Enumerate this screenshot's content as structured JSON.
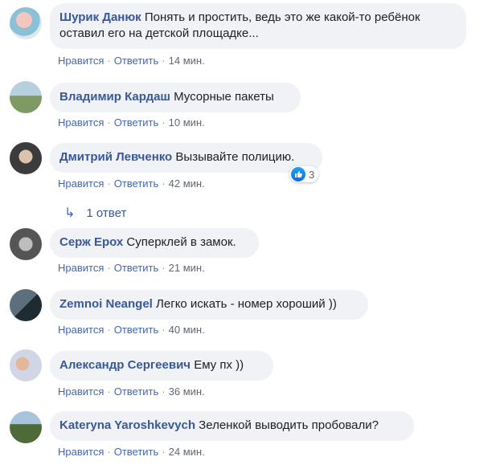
{
  "comments": [
    {
      "author": "Шурик Данюк",
      "text_line1": "Понять и простить, ведь это же какой-то ребёнок",
      "text_line2": "оставил его на детской площадке...",
      "like": "Нравится",
      "reply": "Ответить",
      "time": "14 мин."
    },
    {
      "author": "Владимир Кардаш",
      "text": "Мусорные пакеты",
      "like": "Нравится",
      "reply": "Ответить",
      "time": "10 мин."
    },
    {
      "author": "Дмитрий Левченко",
      "text": "Вызывайте полицию.",
      "like": "Нравится",
      "reply": "Ответить",
      "time": "42 мин.",
      "reaction_count": "3",
      "replies_label": "1 ответ"
    },
    {
      "author": "Серж Ерох",
      "text": "Суперклей в замок.",
      "like": "Нравится",
      "reply": "Ответить",
      "time": "21 мин."
    },
    {
      "author": "Zemnoi Neangel",
      "text": "Легко искать - номер хороший ))",
      "like": "Нравится",
      "reply": "Ответить",
      "time": "40 мин."
    },
    {
      "author": "Александр Сергеевич",
      "text": "Ему пх ))",
      "like": "Нравится",
      "reply": "Ответить",
      "time": "36 мин."
    },
    {
      "author": "Kateryna Yaroshkevych",
      "text": "Зеленкой выводить пробовали?",
      "like": "Нравится",
      "reply": "Ответить",
      "time": "24 мин."
    }
  ],
  "colors": {
    "author": "#385898",
    "link": "#4267b2",
    "bubble": "#f0f2f5",
    "like_reaction": "#1877f2"
  },
  "icons": {
    "reaction": "like-icon",
    "reply_thread": "reply-arrow-icon"
  }
}
